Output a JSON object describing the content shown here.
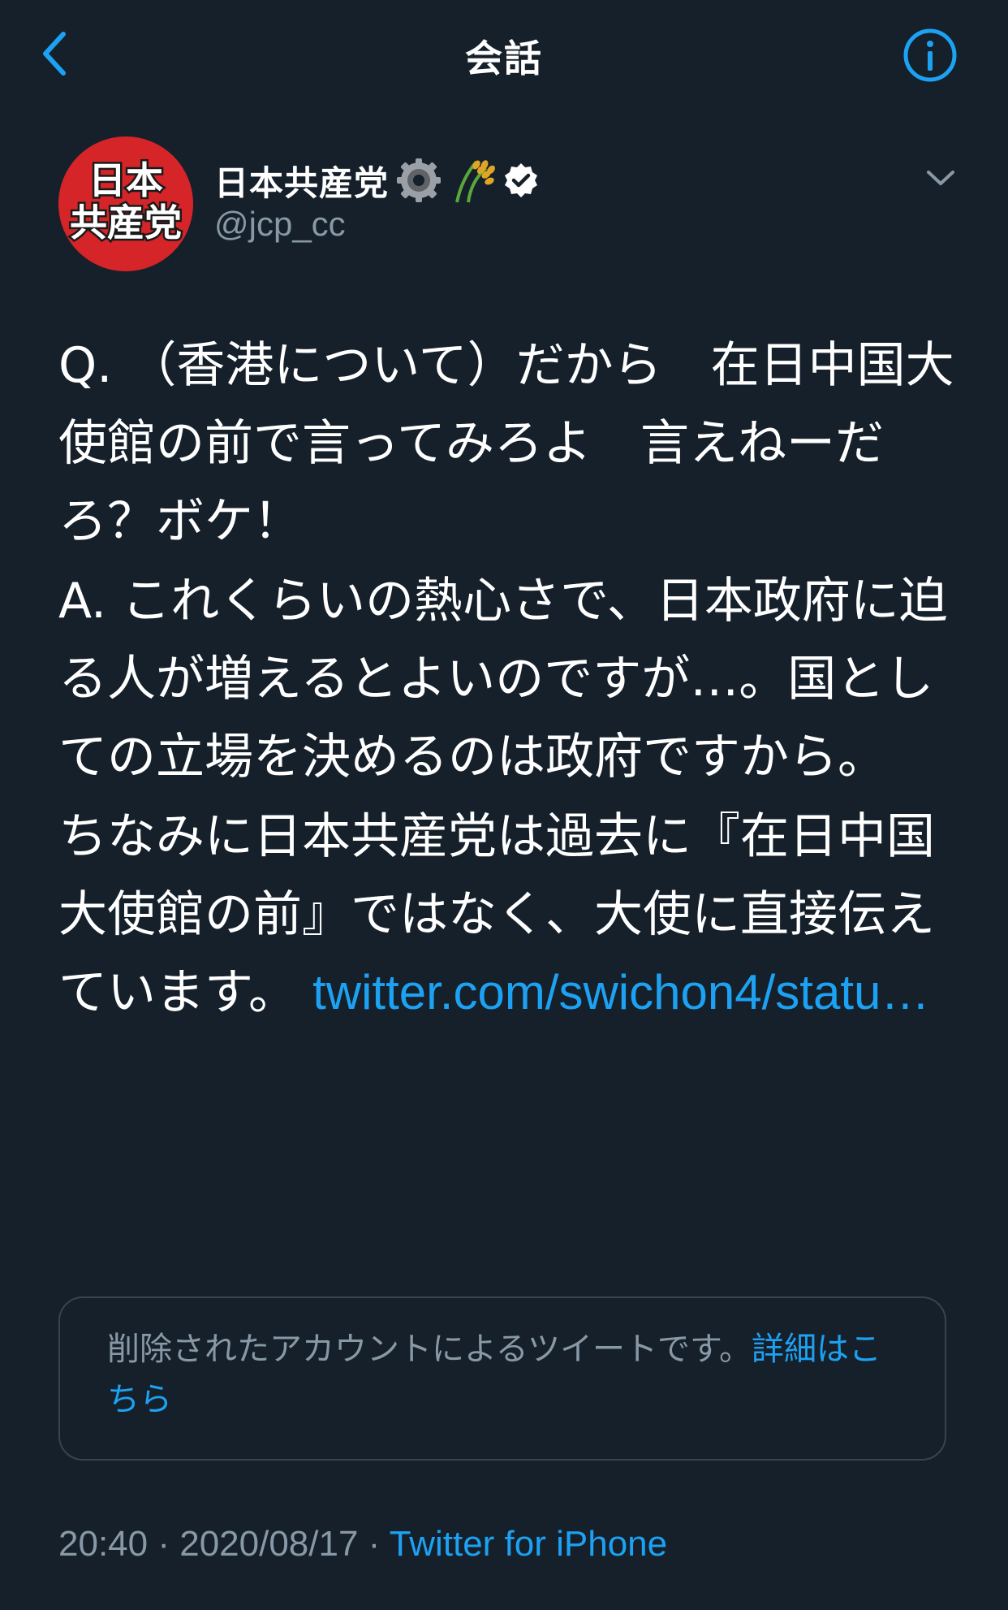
{
  "header": {
    "title": "会話",
    "back_icon": "chevron-left-icon",
    "info_icon": "info-circle-icon"
  },
  "author": {
    "avatar_text_line1": "日本",
    "avatar_text_line2": "共産党",
    "display_name": "日本共産党",
    "emoji_badges": [
      "gear-icon",
      "rice-icon"
    ],
    "verified_icon": "verified-badge-icon",
    "handle": "@jcp_cc"
  },
  "tweet": {
    "paragraph1": "Q. （香港について）だから　在日中国大使館の前で言ってみろよ　言えねーだろ？ボケ！",
    "paragraph2": "A. これくらいの熱心さで、日本政府に迫る人が増えるとよいのですが…。国としての立場を決めるのは政府ですから。",
    "paragraph3_text": "ちなみに日本共産党は過去に『在日中国大使館の前』ではなく、大使に直接伝えています。 ",
    "paragraph3_link": "twitter.com/swichon4/statu…"
  },
  "quoted": {
    "text": "削除されたアカウントによるツイートです。",
    "link": "詳細はこちら"
  },
  "meta": {
    "time": "20:40",
    "separator": " · ",
    "date": "2020/08/17",
    "source": "Twitter for iPhone"
  },
  "colors": {
    "background": "#15202b",
    "accent": "#1da1f2",
    "secondary_text": "#8899a6",
    "avatar_red": "#d52528"
  }
}
